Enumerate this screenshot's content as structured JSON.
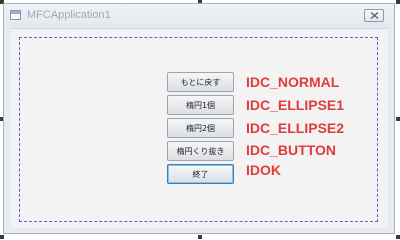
{
  "window": {
    "title": "MFCApplication1"
  },
  "buttons": [
    {
      "label": "もとに戻す"
    },
    {
      "label": "楕円1個"
    },
    {
      "label": "楕円2個"
    },
    {
      "label": "楕円くり抜き"
    },
    {
      "label": "終了"
    }
  ],
  "labels": [
    "IDC_NORMAL",
    "IDC_ELLIPSE1",
    "IDC_ELLIPSE2",
    "IDC_BUTTON",
    "IDOK"
  ],
  "colors": {
    "label_red": "#e13b3b",
    "guide_dash": "#6a58d8"
  }
}
